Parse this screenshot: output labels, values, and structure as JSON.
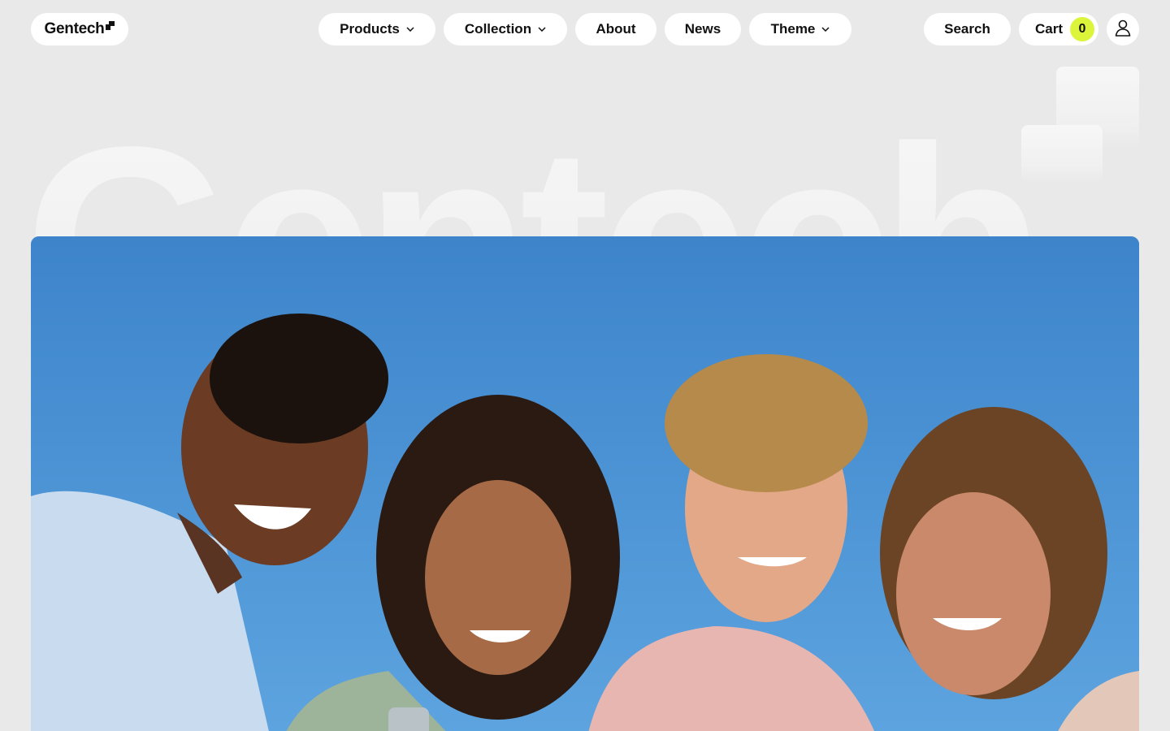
{
  "header": {
    "logo_text": "Gentech",
    "nav": [
      {
        "label": "Products",
        "has_dropdown": true
      },
      {
        "label": "Collection",
        "has_dropdown": true
      },
      {
        "label": "About",
        "has_dropdown": false
      },
      {
        "label": "News",
        "has_dropdown": false
      },
      {
        "label": "Theme",
        "has_dropdown": true
      }
    ],
    "search_label": "Search",
    "cart_label": "Cart",
    "cart_count": "0",
    "account_icon": "user-icon"
  },
  "hero": {
    "wordmark": "Gentech",
    "image_description": "",
    "sky_color": "#4a90d4"
  },
  "colors": {
    "page_background": "#e9e9e9",
    "pill_background": "#ffffff",
    "cart_badge": "#dcf53a",
    "text": "#111111"
  }
}
